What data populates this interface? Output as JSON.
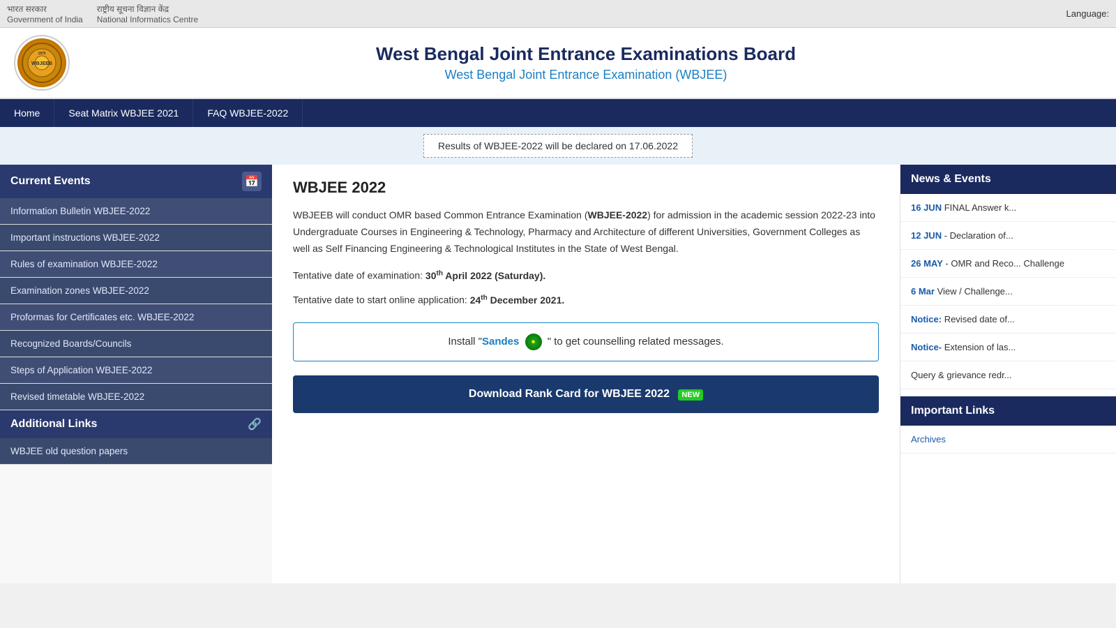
{
  "topbar": {
    "org1": "Government of India",
    "org2": "National Informatics Centre",
    "org1_hindi": "भारत सरकार",
    "org2_hindi": "राष्ट्रीय सूचना विज्ञान केंद्र",
    "language_label": "Language:"
  },
  "header": {
    "title_main": "West Bengal Joint Entrance Examinations Board",
    "title_sub": "West Bengal Joint Entrance Examination (WBJEE)"
  },
  "nav": {
    "items": [
      {
        "label": "Home"
      },
      {
        "label": "Seat Matrix WBJEE 2021"
      },
      {
        "label": "FAQ WBJEE-2022"
      }
    ]
  },
  "announcement": {
    "text": "Results of WBJEE-2022 will be declared on 17.06.2022"
  },
  "sidebar": {
    "current_events_label": "Current Events",
    "items": [
      {
        "label": "Information Bulletin WBJEE-2022"
      },
      {
        "label": "Important instructions WBJEE-2022"
      },
      {
        "label": "Rules of examination WBJEE-2022"
      },
      {
        "label": "Examination zones WBJEE-2022"
      },
      {
        "label": "Proformas for Certificates etc. WBJEE-2022"
      },
      {
        "label": "Recognized Boards/Councils"
      },
      {
        "label": "Steps of Application WBJEE-2022"
      },
      {
        "label": "Revised timetable WBJEE-2022"
      }
    ],
    "additional_links_label": "Additional Links",
    "additional_items": [
      {
        "label": "WBJEE old question papers"
      }
    ]
  },
  "main": {
    "title": "WBJEE 2022",
    "para1": "WBJEEB will conduct OMR based Common Entrance Examination (",
    "para1_bold": "WBJEE-2022",
    "para1_rest": ") for admission in the academic session 2022-23 into Undergraduate Courses in Engineering & Technology, Pharmacy and Architecture of different Universities, Government Colleges as well as Self Financing Engineering & Technological Institutes in the State of West Bengal.",
    "exam_date_prefix": "Tentative date of examination:",
    "exam_date_bold": "30",
    "exam_date_sup": "th",
    "exam_date_suffix": " April 2022 (Saturday).",
    "app_date_prefix": "Tentative date to start online application:",
    "app_date_bold": "24",
    "app_date_sup": "th",
    "app_date_suffix": " December 2021.",
    "sandes_prefix": "Install \"",
    "sandes_name": "Sandes",
    "sandes_suffix": "\" to get counselling related messages.",
    "download_btn": "Download Rank Card for WBJEE 2022",
    "new_badge": "NEW"
  },
  "news_events": {
    "header": "News & Events",
    "items": [
      {
        "date": "16 JUN",
        "text": "FINAL Answer k..."
      },
      {
        "date": "12 JUN",
        "text": "- Declaration of..."
      },
      {
        "date": "26 MAY",
        "text": "- OMR and Reco... Challenge"
      },
      {
        "date": "6 Mar",
        "text": "View / Challenge..."
      },
      {
        "date": "Notice:",
        "text": "Revised date of..."
      },
      {
        "date": "Notice-",
        "text": "Extension of las..."
      },
      {
        "date": "",
        "text": "Query & grievance redr..."
      }
    ]
  },
  "important_links": {
    "header": "Important Links",
    "items": [
      {
        "label": "Archives"
      }
    ]
  }
}
